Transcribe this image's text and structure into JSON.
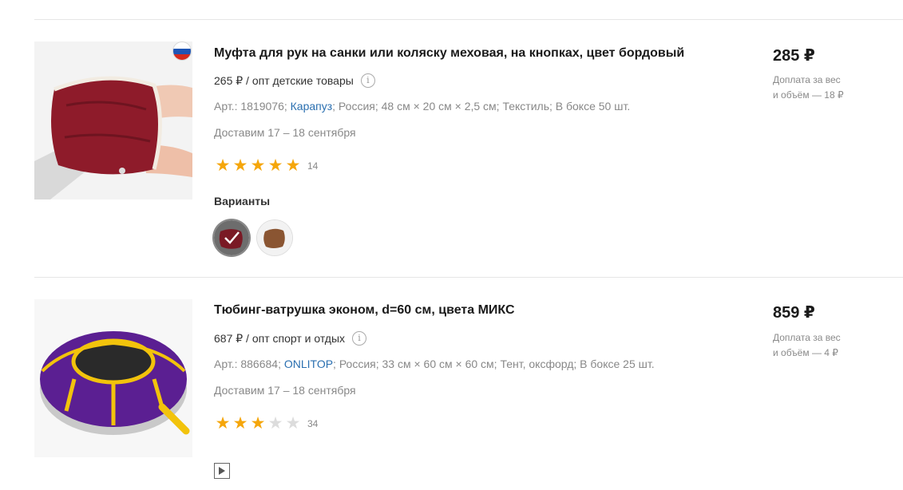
{
  "products": [
    {
      "title": "Муфта для рук на санки или коляску меховая, на кнопках, цвет бордовый",
      "opt_price": "265 ₽",
      "opt_sep": " / ",
      "opt_category": "опт детские товары",
      "attrs": {
        "art": "Арт.: 1819076;",
        "brand": "Карапуз",
        "rest": "; Россия; 48 см × 20 см × 2,5 см; Текстиль; В боксе 50 шт."
      },
      "delivery": "Доставим 17 – 18 сентября",
      "rating": 5,
      "rating_count": "14",
      "variants_label": "Варианты",
      "price": "285 ₽",
      "surcharge_line1": "Доплата за вес",
      "surcharge_line2": "и объём — 18 ₽",
      "image_icon": "burgundy-hand-muff-photo",
      "badge_icon": "russia-flag-icon"
    },
    {
      "title": "Тюбинг-ватрушка эконом, d=60 см, цвета МИКС",
      "opt_price": "687 ₽",
      "opt_sep": " / ",
      "opt_category": "опт спорт и отдых",
      "attrs": {
        "art": "Арт.: 886684;",
        "brand": "ONLITOP",
        "rest": "; Россия; 33 см × 60 см × 60 см; Тент, оксфорд; В боксе 25 шт."
      },
      "delivery": "Доставим 17 – 18 сентября",
      "rating": 3,
      "rating_count": "34",
      "price": "859 ₽",
      "surcharge_line1": "Доплата за вес",
      "surcharge_line2": "и объём — 4 ₽",
      "image_icon": "purple-snow-tube-photo",
      "video_icon": "play-icon"
    }
  ],
  "colors": {
    "star_on": "#f5a60a",
    "star_off": "#dcdcdc",
    "brand_link": "#2a6fb0"
  }
}
